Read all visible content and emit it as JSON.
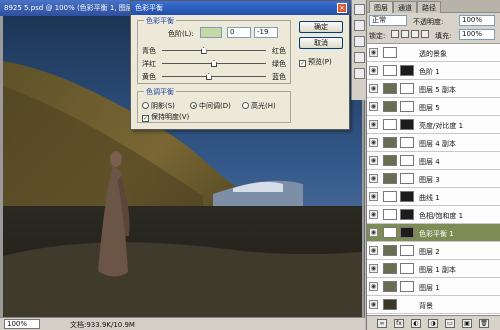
{
  "document": {
    "title": "8925 5.psd @ 100% (色彩平衡 1, 图层蒙版/8)",
    "zoom": "100%",
    "doc_size": "文档:933.9K/10.9M"
  },
  "dialog": {
    "title": "色彩平衡",
    "close_glyph": "×",
    "color_balance_group": "色彩平衡",
    "levels_label": "色阶(L):",
    "levels": [
      "",
      "0",
      "-19"
    ],
    "sliders": [
      {
        "left": "青色",
        "right": "红色",
        "value": -20
      },
      {
        "left": "洋红",
        "right": "绿色",
        "value": 0
      },
      {
        "left": "黄色",
        "right": "蓝色",
        "value": -10
      }
    ],
    "tone_group": "色调平衡",
    "tones": [
      "阴影(S)",
      "中间调(D)",
      "高光(H)"
    ],
    "selected_tone": "中间调(D)",
    "preserve_luminosity": "保持明度(V)",
    "preserve_checked": true,
    "ok_label": "确定",
    "cancel_label": "取消",
    "preview_label": "预览(P)",
    "preview_checked": true
  },
  "layers_panel": {
    "tabs": [
      "图层",
      "通道",
      "路径"
    ],
    "blend_mode": "正常",
    "opacity_label": "不透明度:",
    "opacity_value": "100%",
    "lock_label": "锁定:",
    "fill_label": "填充:",
    "fill_value": "100%",
    "layers": [
      {
        "name": "透的景象",
        "kind": "group"
      },
      {
        "name": "色阶 1",
        "kind": "adjustment"
      },
      {
        "name": "图层 5 副本",
        "kind": "normal"
      },
      {
        "name": "图层 5",
        "kind": "normal"
      },
      {
        "name": "亮度/对比度 1",
        "kind": "adjustment"
      },
      {
        "name": "图层 4 副本",
        "kind": "normal"
      },
      {
        "name": "图层 4",
        "kind": "normal"
      },
      {
        "name": "图层 3",
        "kind": "normal"
      },
      {
        "name": "曲线 1",
        "kind": "adjustment"
      },
      {
        "name": "色相/饱和度 1",
        "kind": "adjustment"
      },
      {
        "name": "色彩平衡 1",
        "kind": "adjustment",
        "selected": true
      },
      {
        "name": "图层 2",
        "kind": "normal"
      },
      {
        "name": "图层 1 副本",
        "kind": "normal"
      },
      {
        "name": "图层 1",
        "kind": "normal"
      },
      {
        "name": "背景",
        "kind": "background"
      }
    ],
    "footer_icons": [
      "link-icon",
      "fx-icon",
      "mask-icon",
      "adjustment-icon",
      "folder-icon",
      "new-layer-icon",
      "trash-icon"
    ]
  },
  "colors": {
    "title_blue": "#2d4f9c",
    "selected_layer": "#7d8c55"
  }
}
